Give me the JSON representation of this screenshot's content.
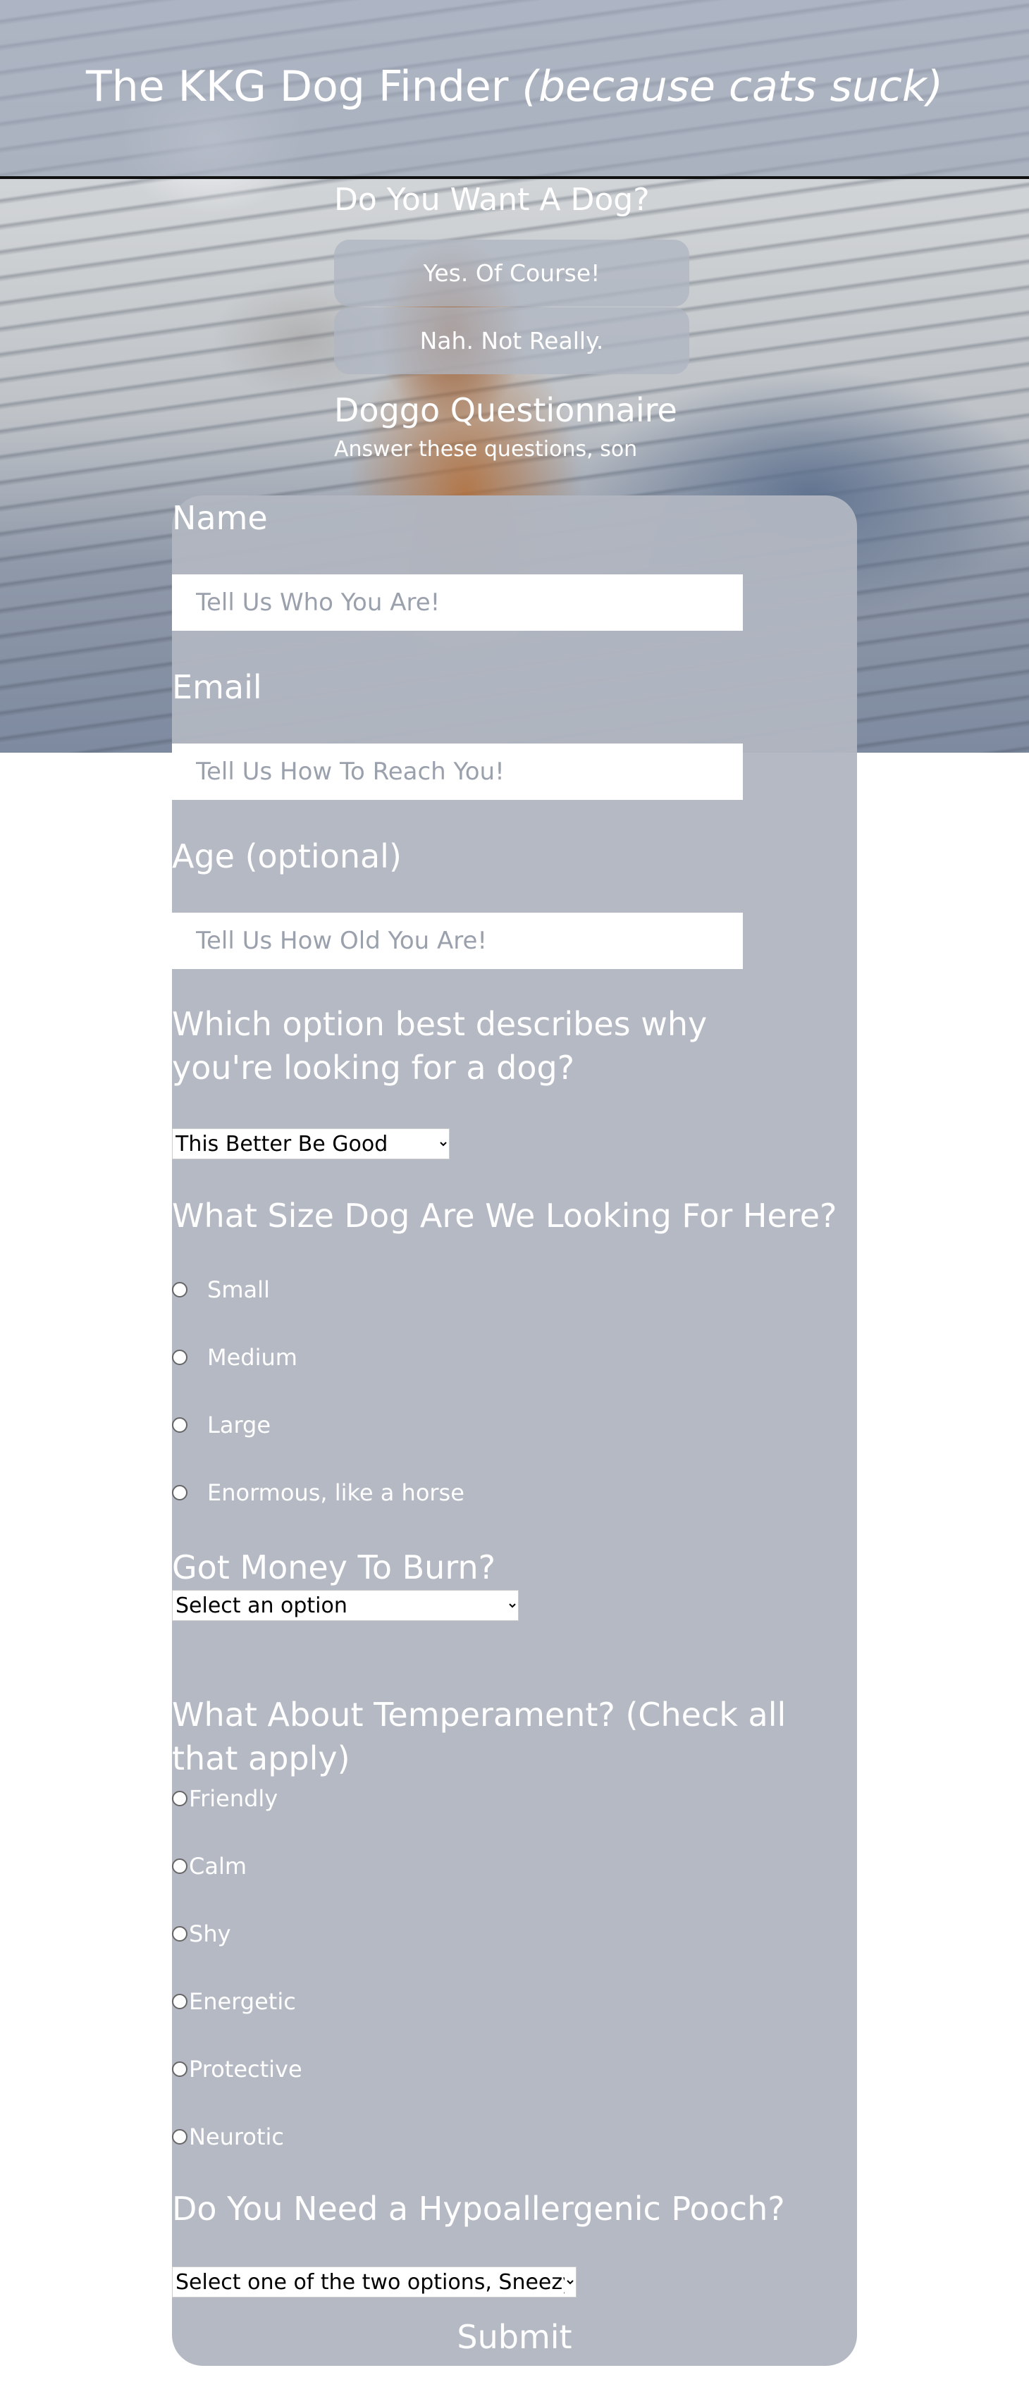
{
  "header": {
    "title_main": "The KKG Dog Finder",
    "title_italic": "(because cats suck)"
  },
  "adopt": {
    "heading": "Do You Want A Dog?",
    "yes_label": "Yes. Of Course!",
    "no_label": "Nah. Not Really."
  },
  "questionnaire": {
    "heading": "Doggo Questionnaire",
    "subheading": "Answer these questions, son"
  },
  "form": {
    "name": {
      "label": "Name",
      "placeholder": "Tell Us Who You Are!"
    },
    "email": {
      "label": "Email",
      "placeholder": "Tell Us How To Reach You!"
    },
    "age": {
      "label": "Age (optional)",
      "placeholder": "Tell Us How Old You Are!"
    },
    "reason": {
      "label": "Which option best describes why you're looking for a dog?",
      "selected": "This Better Be Good"
    },
    "size": {
      "label": "What Size Dog Are We Looking For Here?",
      "options": [
        "Small",
        "Medium",
        "Large",
        "Enormous, like a horse"
      ]
    },
    "budget": {
      "label": "Got Money To Burn?",
      "selected": "Select an option"
    },
    "temperament": {
      "label": "What About Temperament? (Check all that apply)",
      "options": [
        "Friendly",
        "Calm",
        "Shy",
        "Energetic",
        "Protective",
        "Neurotic"
      ]
    },
    "hypoallergenic": {
      "label": "Do You Need a Hypoallergenic Pooch?",
      "selected": "Select one of the two options, Sneezy"
    },
    "submit_label": "Submit"
  }
}
